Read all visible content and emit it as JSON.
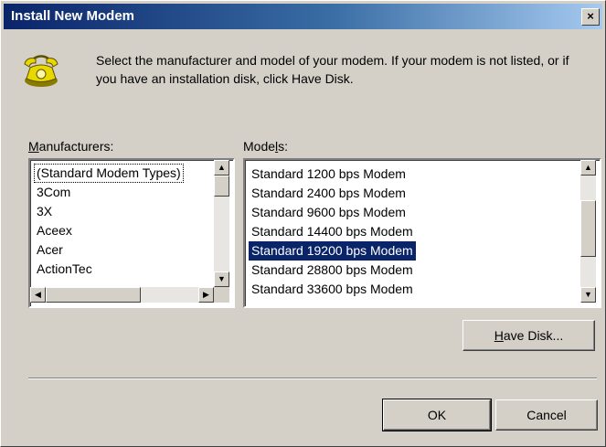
{
  "window": {
    "title": "Install New Modem"
  },
  "instructions": "Select the manufacturer and model of your modem. If your modem is not listed, or if you have an installation disk, click Have Disk.",
  "manufacturers": {
    "label_accel": "M",
    "label_rest": "anufacturers:",
    "items": [
      "(Standard Modem Types)",
      "3Com",
      "3X",
      "Aceex",
      "Acer",
      "ActionTec"
    ]
  },
  "models": {
    "label_pre": "Mode",
    "label_accel": "l",
    "label_post": "s:",
    "items": [
      "Standard  1200 bps Modem",
      "Standard  2400 bps Modem",
      "Standard  9600 bps Modem",
      "Standard 14400 bps Modem",
      "Standard 19200 bps Modem",
      "Standard 28800 bps Modem",
      "Standard 33600 bps Modem"
    ],
    "selected": "Standard 19200 bps Modem"
  },
  "buttons": {
    "have_disk_accel": "H",
    "have_disk_rest": "ave Disk...",
    "ok": "OK",
    "cancel": "Cancel",
    "close": "×"
  },
  "icons": {
    "modem": "telephone-icon",
    "scroll_up": "▲",
    "scroll_down": "▼",
    "scroll_left": "◀",
    "scroll_right": "▶"
  }
}
